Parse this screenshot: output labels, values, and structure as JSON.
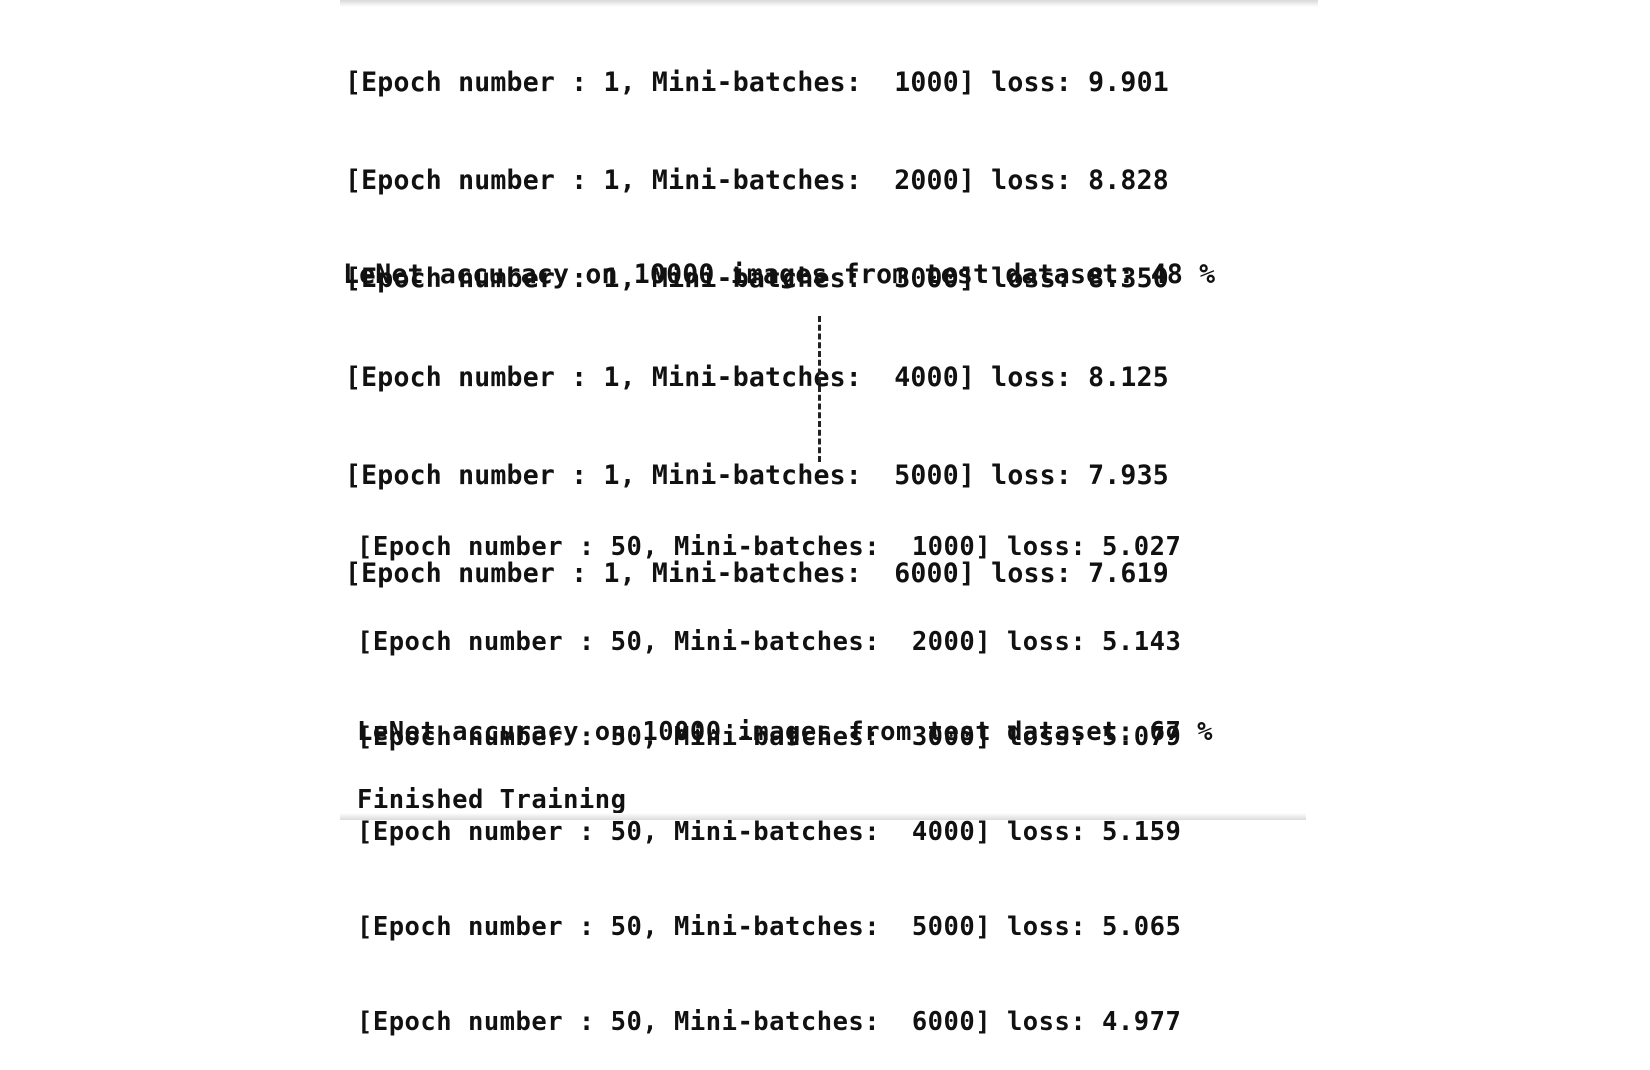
{
  "terminal": {
    "epoch_1": {
      "lines": [
        "[Epoch number : 1, Mini-batches:  1000] loss: 9.901",
        "[Epoch number : 1, Mini-batches:  2000] loss: 8.828",
        "[Epoch number : 1, Mini-batches:  3000] loss: 8.350",
        "[Epoch number : 1, Mini-batches:  4000] loss: 8.125",
        "[Epoch number : 1, Mini-batches:  5000] loss: 7.935",
        "[Epoch number : 1, Mini-batches:  6000] loss: 7.619"
      ],
      "accuracy_line": "LeNet accuracy on 10000 images from test dataset: 48 %"
    },
    "epoch_50": {
      "lines": [
        "[Epoch number : 50, Mini-batches:  1000] loss: 5.027",
        "[Epoch number : 50, Mini-batches:  2000] loss: 5.143",
        "[Epoch number : 50, Mini-batches:  3000] loss: 5.079",
        "[Epoch number : 50, Mini-batches:  4000] loss: 5.159",
        "[Epoch number : 50, Mini-batches:  5000] loss: 5.065",
        "[Epoch number : 50, Mini-batches:  6000] loss: 4.977"
      ],
      "accuracy_line": "LeNet accuracy on 10000 images from test dataset: 67 %"
    },
    "finished_line": "Finished Training"
  }
}
